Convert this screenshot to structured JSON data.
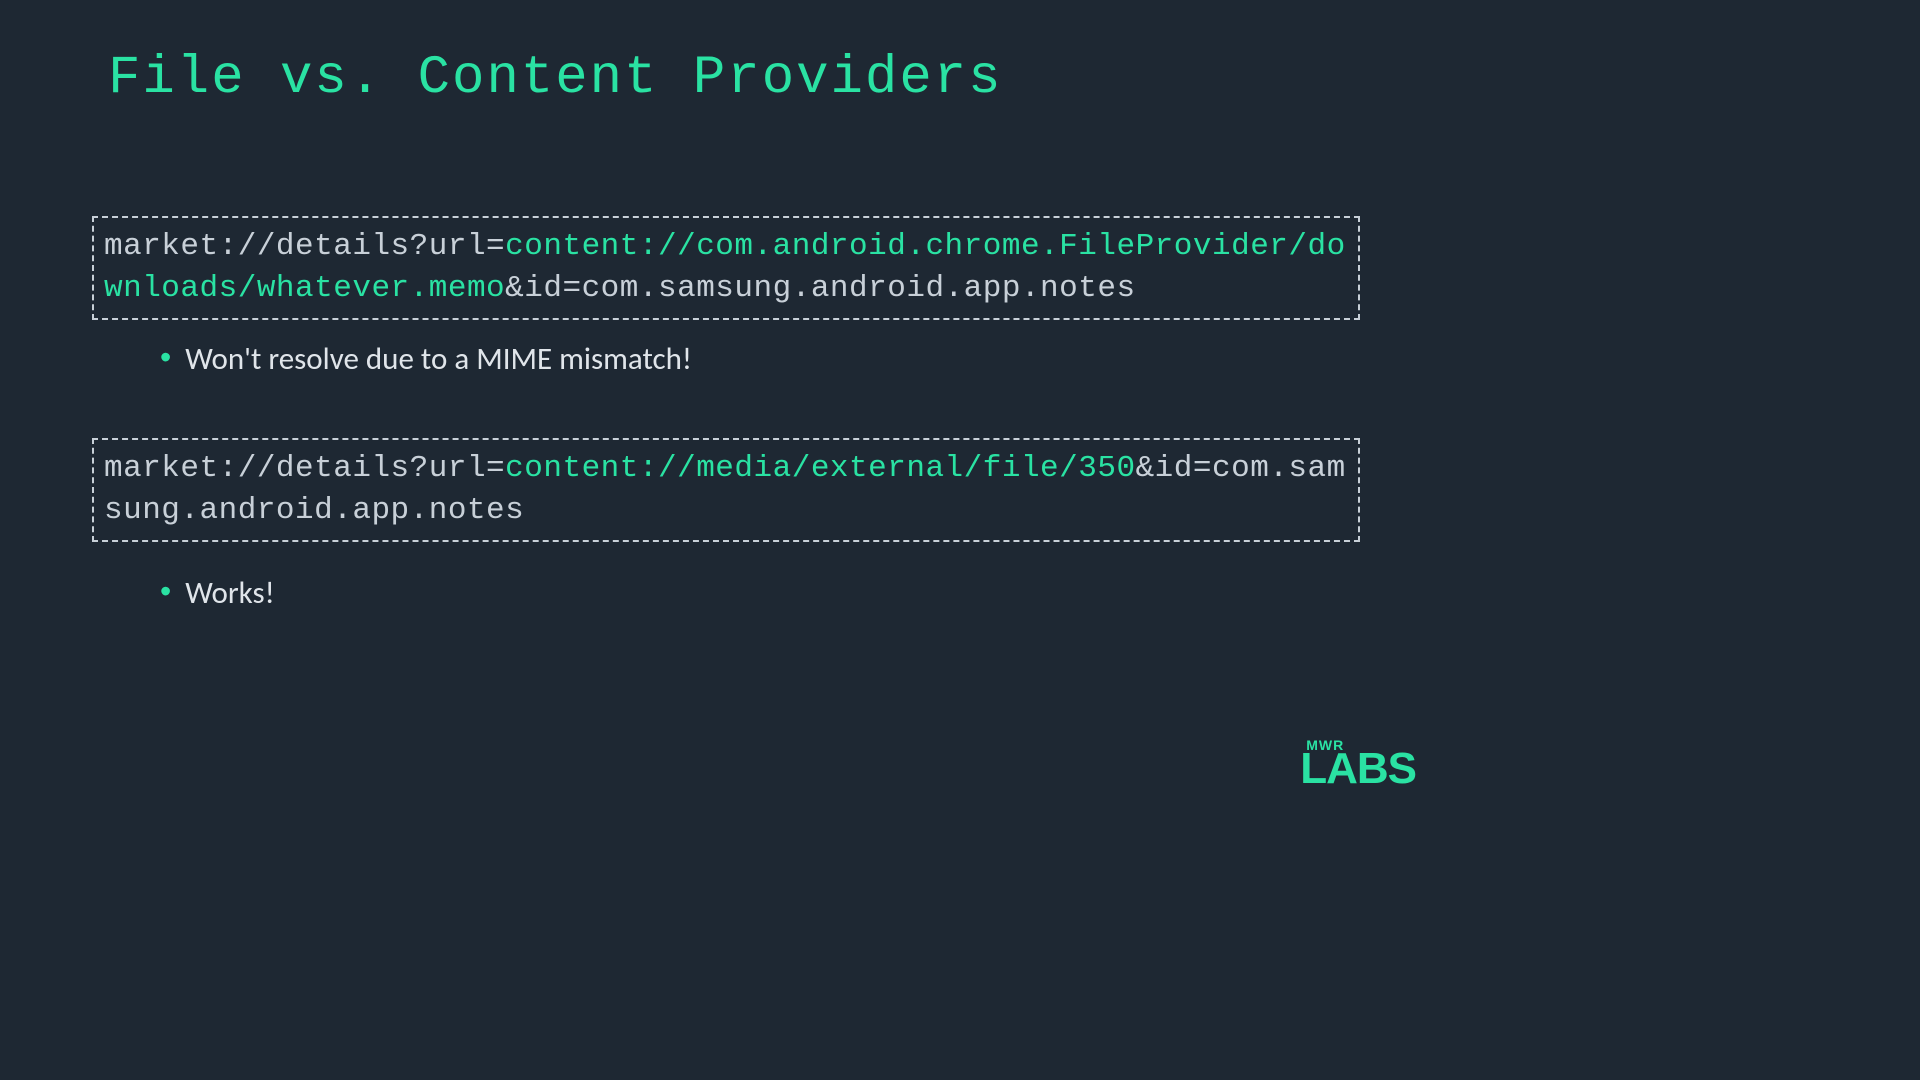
{
  "colors": {
    "background": "#1e2833",
    "accent": "#2ae2a3",
    "text": "#c8d0d8",
    "bullet_text": "#e0e5ea"
  },
  "title": "File vs. Content Providers",
  "code_box_1": {
    "prefix": "market://details?url=",
    "highlighted": "content://com.android.chrome.FileProvider/downloads/whatever.memo",
    "suffix": "&id=com.samsung.android.app.notes"
  },
  "bullet_1": "Won't resolve due to a MIME mismatch!",
  "code_box_2": {
    "prefix": "market://details?url=",
    "highlighted": "content://media/external/file/350",
    "suffix": "&id=com.samsung.android.app.notes"
  },
  "bullet_2": "Works!",
  "logo": {
    "top": "MWR",
    "bottom": "LABS"
  }
}
